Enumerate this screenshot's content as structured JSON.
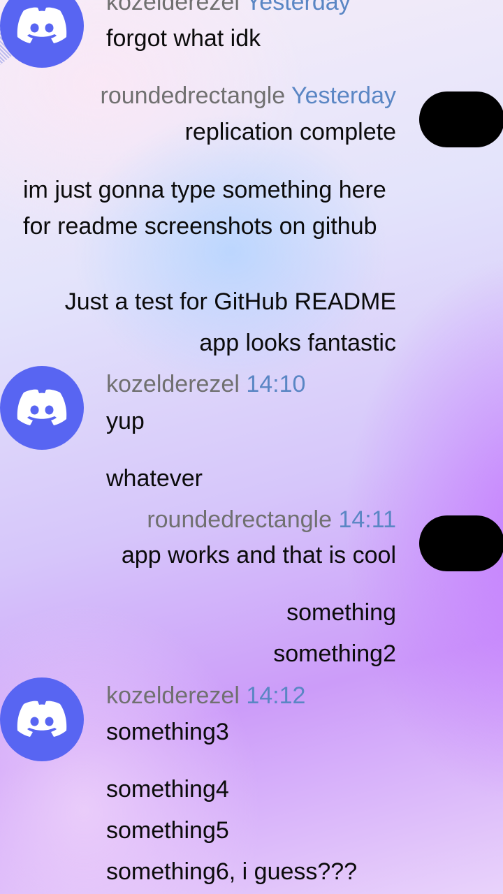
{
  "colors": {
    "avatar": "#5865f2",
    "username": "#707070",
    "timestamp": "#5a86c4",
    "message": "#0b0b0b"
  },
  "icons": {
    "avatar": "discord-logo-icon"
  },
  "messages": [
    {
      "author": "kozelderezel",
      "time": "Yesterday",
      "lines": [
        "forgot what idk"
      ]
    },
    {
      "author": "roundedrectangle",
      "time": "Yesterday",
      "lines": [
        "replication complete"
      ]
    },
    {
      "lines": [
        "im just gonna type something here for readme screenshots on github",
        "Just a test for GitHub README",
        "app looks fantastic"
      ]
    },
    {
      "author": "kozelderezel",
      "time": "14:10",
      "lines": [
        "yup",
        "whatever"
      ]
    },
    {
      "author": "roundedrectangle",
      "time": "14:11",
      "lines": [
        "app works and that is cool",
        "something",
        "something2"
      ]
    },
    {
      "author": "kozelderezel",
      "time": "14:12",
      "lines": [
        "something3",
        "something4",
        "something5",
        "something6, i guess???"
      ]
    }
  ]
}
